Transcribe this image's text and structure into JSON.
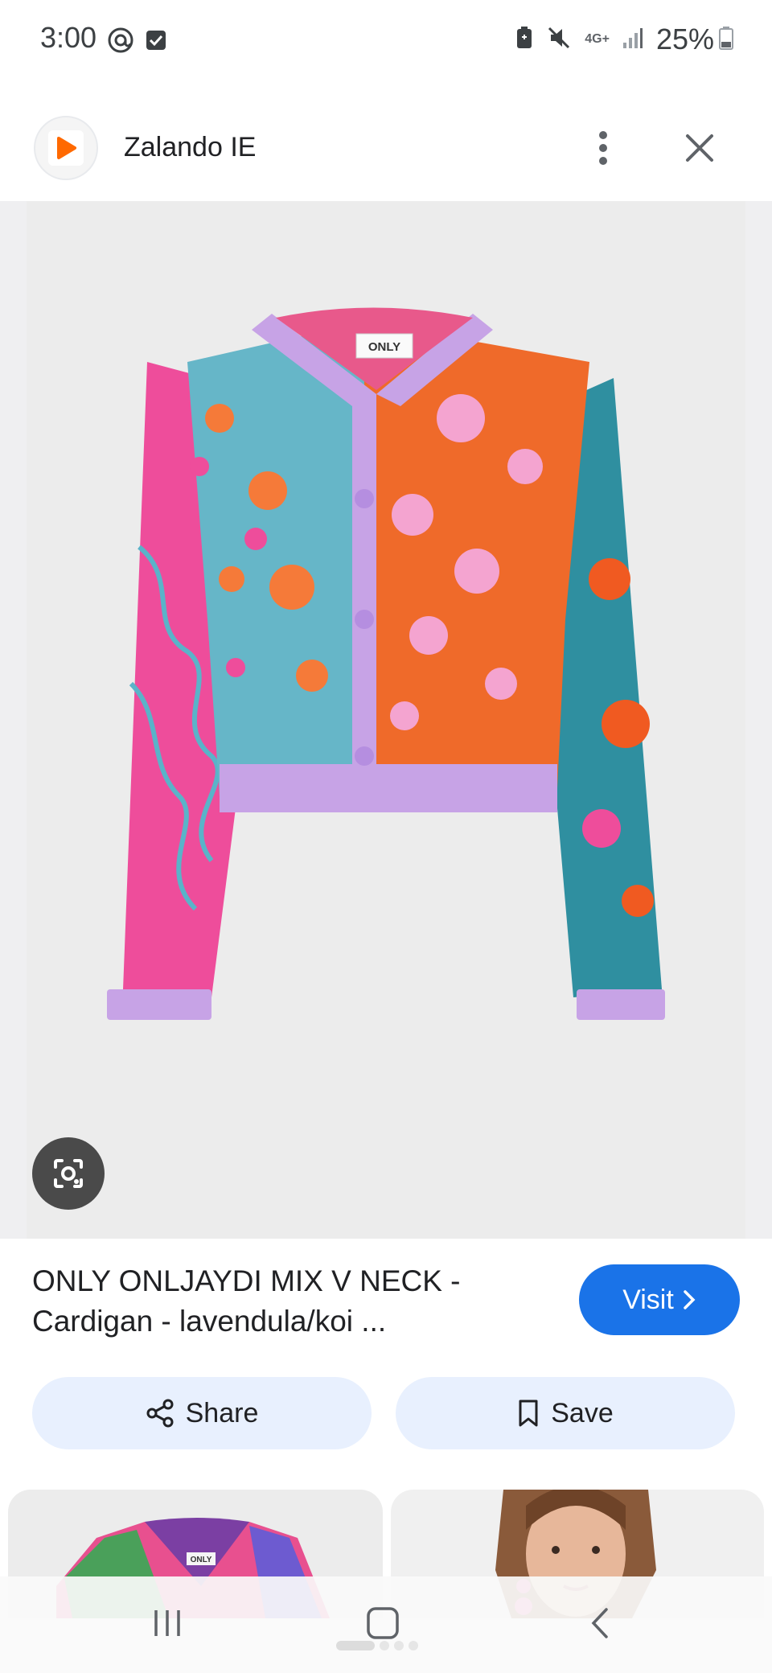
{
  "status_bar": {
    "time": "3:00",
    "network": "4G+",
    "battery": "25%",
    "icons": [
      "at-sign-icon",
      "checkbox-icon",
      "battery-saver-icon",
      "mute-icon",
      "signal-icon",
      "battery-icon"
    ]
  },
  "header": {
    "app_name": "Zalando IE",
    "logo_icon": "zalando-logo-icon",
    "brand_color": "#ff6900"
  },
  "product": {
    "title": "ONLY ONLJAYDI MIX V NECK - Cardigan - lavendula/koi ...",
    "label_text": "ONLY"
  },
  "actions": {
    "visit_label": "Visit",
    "share_label": "Share",
    "save_label": "Save",
    "accent_color": "#1a73e8"
  },
  "related": {
    "thumb1_label": "ONLY"
  }
}
